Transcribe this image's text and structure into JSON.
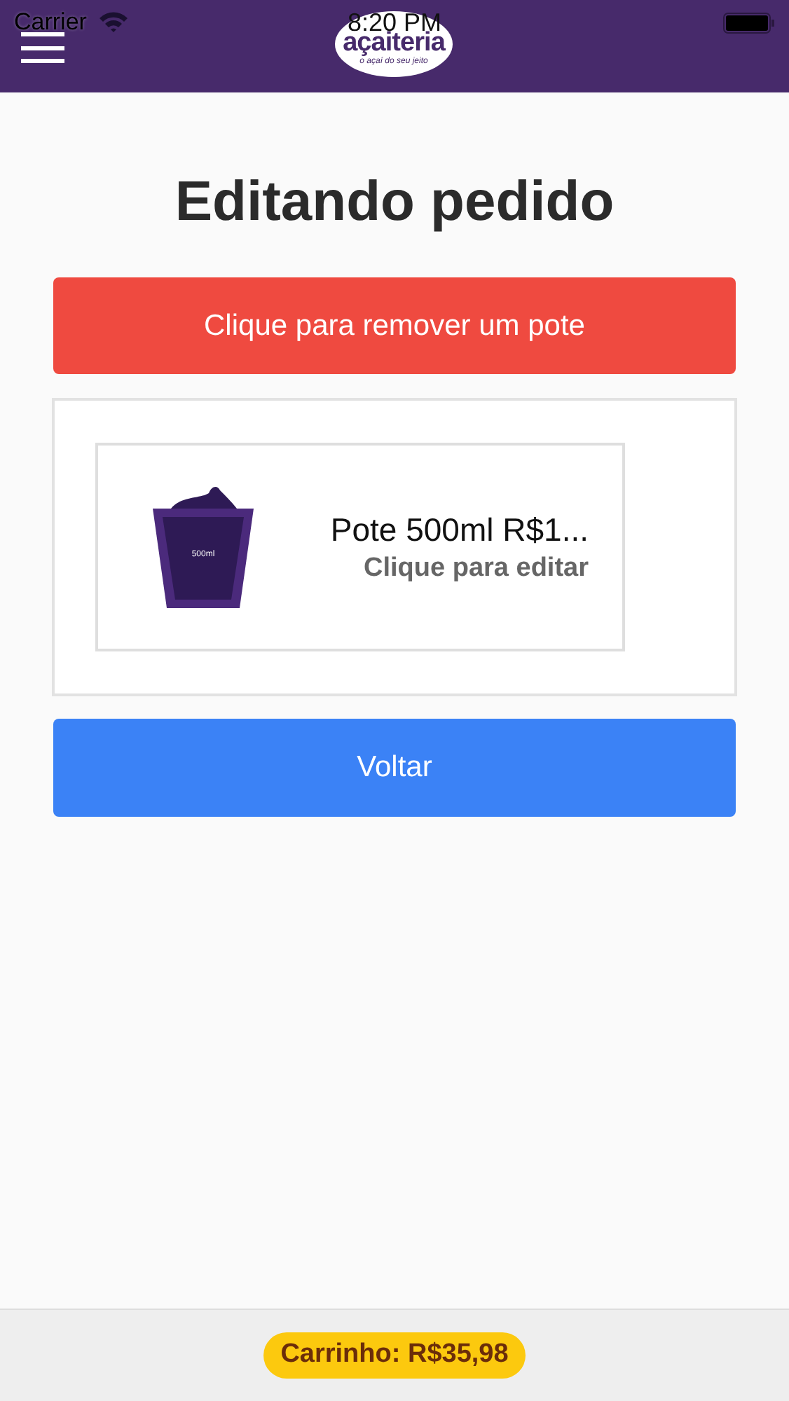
{
  "status_bar": {
    "carrier": "Carrier",
    "time": "8:20 PM"
  },
  "header": {
    "logo_name": "açaiteria",
    "logo_tagline": "o açaí do seu jeito"
  },
  "title": "Editando pedido",
  "remove_button": "Clique para remover um pote",
  "items": [
    {
      "kind": "pote",
      "pot_label": "500ml",
      "name": "Pote 500ml R$1...",
      "action": "Clique para editar"
    }
  ],
  "back_button": "Voltar",
  "cart": {
    "label": "Carrinho: R$35,98"
  }
}
